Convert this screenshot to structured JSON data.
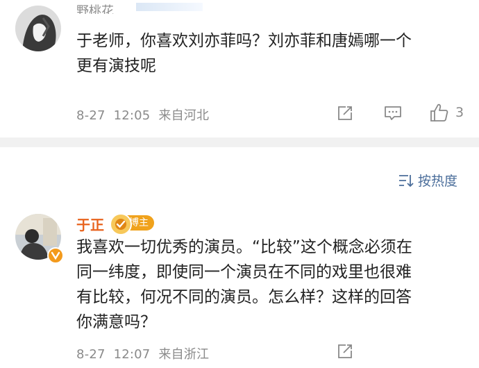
{
  "comment1": {
    "username": "野桃花",
    "text_line1": "于老师，你喜欢刘亦菲吗？刘亦菲和唐嫣哪一个",
    "text_line2": "更有演技呢",
    "date": "8-27",
    "time": "12:05",
    "location": "来自河北",
    "like_count": "3"
  },
  "sort": {
    "label": "按热度"
  },
  "reply": {
    "author": "于正",
    "badge": "博主",
    "text_lines": [
      "我喜欢一切优秀的演员。“比较”这个概念必须在",
      "同一纬度，即使同一个演员在不同的戏里也很难",
      "有比较，何况不同的演员。怎么样？这样的回答",
      "你满意吗？"
    ],
    "date": "8-27",
    "time": "12:07",
    "location": "来自浙江"
  },
  "icons": {
    "share": "share-icon",
    "comment": "comment-icon",
    "like": "thumbs-up-icon",
    "sort": "sort-icon",
    "verified": "verified-badge-icon"
  },
  "colors": {
    "author_name": "#e8631d",
    "badge": "#f0a21c",
    "sort_text": "#4a6d9a",
    "meta": "#8a8a8a",
    "divider": "#f1f1f1"
  }
}
